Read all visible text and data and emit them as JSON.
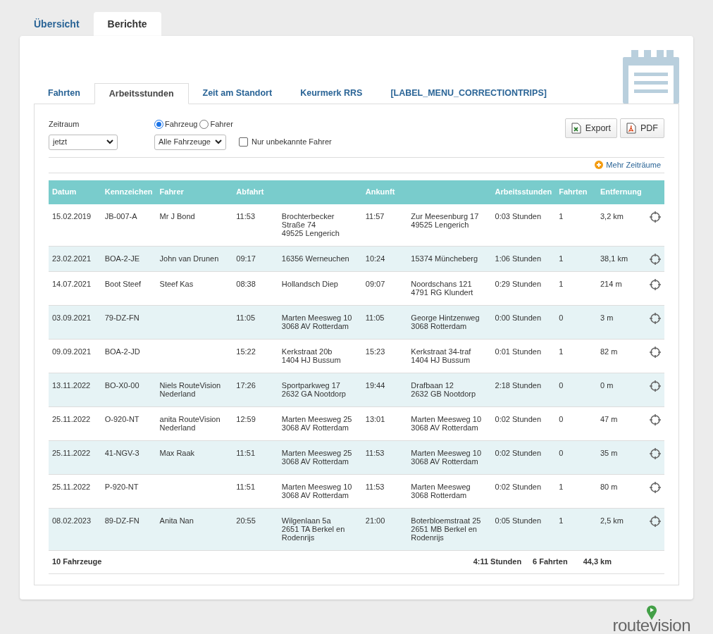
{
  "main_tabs": [
    {
      "label": "Übersicht",
      "selected": false
    },
    {
      "label": "Berichte",
      "selected": true
    }
  ],
  "sub_tabs": [
    {
      "label": "Fahrten",
      "selected": false
    },
    {
      "label": "Arbeitsstunden",
      "selected": true
    },
    {
      "label": "Zeit am Standort",
      "selected": false
    },
    {
      "label": "Keurmerk RRS",
      "selected": false
    },
    {
      "label": "[LABEL_MENU_CORRECTIONTRIPS]",
      "selected": false
    }
  ],
  "filters": {
    "period_label": "Zeitraum",
    "period_value": "jetzt",
    "mode_options": [
      {
        "label": "Fahrzeug",
        "selected": true
      },
      {
        "label": "Fahrer",
        "selected": false
      }
    ],
    "vehicle_value": "Alle Fahrzeuge",
    "unknown_drivers": {
      "label": "Nur unbekannte Fahrer",
      "checked": false
    }
  },
  "buttons": [
    {
      "kind": "excel",
      "label": "Export"
    },
    {
      "kind": "pdf",
      "label": "PDF"
    }
  ],
  "more_periods": "Mehr Zeiträume",
  "table": {
    "columns": [
      "Datum",
      "Kennzeichen",
      "Fahrer",
      "Abfahrt",
      "",
      "Ankunft",
      "",
      "Arbeitsstunden",
      "Fahrten",
      "Entfernung"
    ],
    "rows": [
      {
        "date": "15.02.2019",
        "plate": "JB-007-A",
        "driver": "Mr J Bond",
        "dep_time": "11:53",
        "dep_address": [
          "Brochterbecker",
          "Straße 74",
          "49525 Lengerich"
        ],
        "arr_time": "11:57",
        "arr_address": [
          "Zur Meesenburg 17",
          "49525 Lengerich"
        ],
        "hours": "0:03 Stunden",
        "trips": "1",
        "distance": "3,2 km"
      },
      {
        "date": "23.02.2021",
        "plate": "BOA-2-JE",
        "driver": "John van Drunen",
        "dep_time": "09:17",
        "dep_address": [
          "16356 Werneuchen"
        ],
        "arr_time": "10:24",
        "arr_address": [
          "15374 Müncheberg"
        ],
        "hours": "1:06 Stunden",
        "trips": "1",
        "distance": "38,1 km"
      },
      {
        "date": "14.07.2021",
        "plate": "Boot Steef",
        "driver": "Steef Kas",
        "dep_time": "08:38",
        "dep_address": [
          "Hollandsch Diep"
        ],
        "arr_time": "09:07",
        "arr_address": [
          "Noordschans 121",
          "4791 RG Klundert"
        ],
        "hours": "0:29 Stunden",
        "trips": "1",
        "distance": "214 m"
      },
      {
        "date": "03.09.2021",
        "plate": "79-DZ-FN",
        "driver": "",
        "dep_time": "11:05",
        "dep_address": [
          "Marten Meesweg 10",
          "3068 AV Rotterdam"
        ],
        "arr_time": "11:05",
        "arr_address": [
          "George Hintzenweg",
          "3068 Rotterdam"
        ],
        "hours": "0:00 Stunden",
        "trips": "0",
        "distance": "3 m"
      },
      {
        "date": "09.09.2021",
        "plate": "BOA-2-JD",
        "driver": "",
        "dep_time": "15:22",
        "dep_address": [
          "Kerkstraat 20b",
          "1404 HJ Bussum"
        ],
        "arr_time": "15:23",
        "arr_address": [
          "Kerkstraat 34-traf",
          "1404 HJ Bussum"
        ],
        "hours": "0:01 Stunden",
        "trips": "1",
        "distance": "82 m"
      },
      {
        "date": "13.11.2022",
        "plate": "BO-X0-00",
        "driver": "Niels RouteVision Nederland",
        "dep_time": "17:26",
        "dep_address": [
          "Sportparkweg 17",
          "2632 GA Nootdorp"
        ],
        "arr_time": "19:44",
        "arr_address": [
          "Drafbaan 12",
          "2632 GB Nootdorp"
        ],
        "hours": "2:18 Stunden",
        "trips": "0",
        "distance": "0 m"
      },
      {
        "date": "25.11.2022",
        "plate": "O-920-NT",
        "driver": "anita RouteVision Nederland",
        "dep_time": "12:59",
        "dep_address": [
          "Marten Meesweg 25",
          "3068 AV Rotterdam"
        ],
        "arr_time": "13:01",
        "arr_address": [
          "Marten Meesweg 10",
          "3068 AV Rotterdam"
        ],
        "hours": "0:02 Stunden",
        "trips": "0",
        "distance": "47 m"
      },
      {
        "date": "25.11.2022",
        "plate": "41-NGV-3",
        "driver": "Max Raak",
        "dep_time": "11:51",
        "dep_address": [
          "Marten Meesweg 25",
          "3068 AV Rotterdam"
        ],
        "arr_time": "11:53",
        "arr_address": [
          "Marten Meesweg 10",
          "3068 AV Rotterdam"
        ],
        "hours": "0:02 Stunden",
        "trips": "0",
        "distance": "35 m"
      },
      {
        "date": "25.11.2022",
        "plate": "P-920-NT",
        "driver": "",
        "dep_time": "11:51",
        "dep_address": [
          "Marten Meesweg 10",
          "3068 AV Rotterdam"
        ],
        "arr_time": "11:53",
        "arr_address": [
          "Marten Meesweg",
          "3068 Rotterdam"
        ],
        "hours": "0:02 Stunden",
        "trips": "1",
        "distance": "80 m"
      },
      {
        "date": "08.02.2023",
        "plate": "89-DZ-FN",
        "driver": "Anita Nan",
        "dep_time": "20:55",
        "dep_address": [
          "Wilgenlaan 5a",
          "2651 TA Berkel en",
          "Rodenrijs"
        ],
        "arr_time": "21:00",
        "arr_address": [
          "Boterbloemstraat 25",
          "2651 MB Berkel en",
          "Rodenrijs"
        ],
        "hours": "0:05 Stunden",
        "trips": "1",
        "distance": "2,5 km"
      }
    ],
    "footer": {
      "count": "10 Fahrzeuge",
      "hours": "4:11 Stunden",
      "trips": "6 Fahrten",
      "distance": "44,3 km"
    }
  },
  "logo": "routevision"
}
